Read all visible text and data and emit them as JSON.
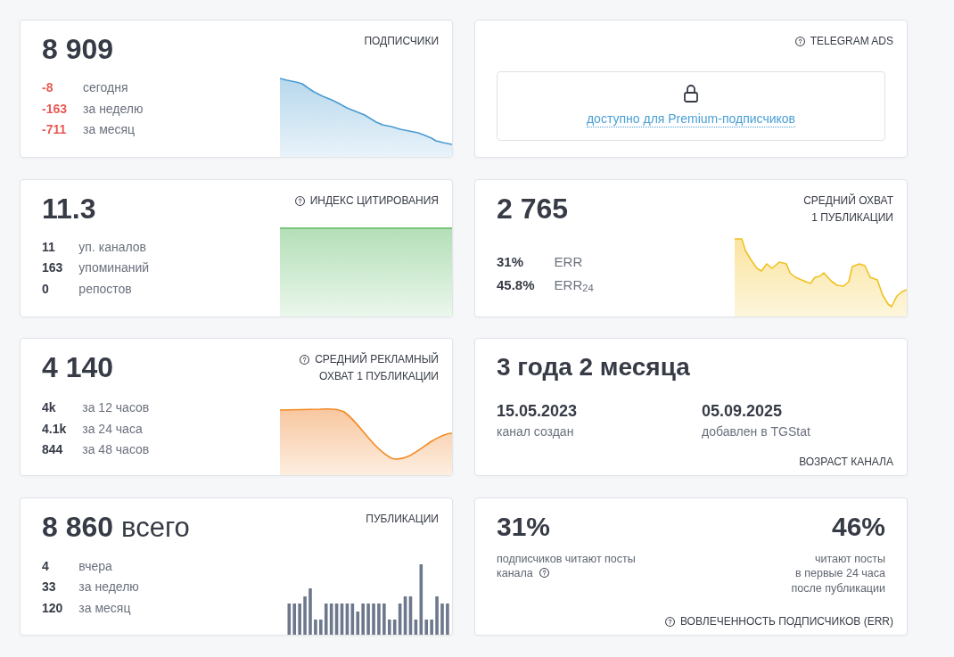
{
  "cards": [
    {
      "kind": "stat",
      "value": "8 909",
      "title_lines": [
        "ПОДПИСЧИКИ"
      ],
      "info_icon": false,
      "stats": [
        {
          "value": "-8",
          "label": "сегодня",
          "negative": true
        },
        {
          "value": "-163",
          "label": "за неделю",
          "negative": true
        },
        {
          "value": "-711",
          "label": "за месяц",
          "negative": true
        }
      ]
    },
    {
      "kind": "locked",
      "title_lines": [
        "TELEGRAM ADS"
      ],
      "info_icon": true,
      "link": "доступно для Premium-подписчиков"
    },
    {
      "kind": "stat",
      "value": "11.3",
      "title_lines": [
        "ИНДЕКС ЦИТИРОВАНИЯ"
      ],
      "info_icon": true,
      "stats": [
        {
          "value": "11",
          "label": "уп. каналов",
          "negative": false
        },
        {
          "value": "163",
          "label": "упоминаний",
          "negative": false
        },
        {
          "value": "0",
          "label": "репостов",
          "negative": false
        }
      ]
    },
    {
      "kind": "stat",
      "value": "2 765",
      "title_lines": [
        "СРЕДНИЙ ОХВАТ",
        "1 ПУБЛИКАЦИИ"
      ],
      "info_icon": false,
      "stats": [
        {
          "value": "31%",
          "label": "ERR",
          "negative": false
        },
        {
          "value": "45.8%",
          "label": "ERR$_{24}$",
          "negative": false
        }
      ]
    },
    {
      "kind": "stat",
      "value": "4 140",
      "title_lines": [
        "СРЕДНИЙ РЕКЛАМНЫЙ",
        "ОХВАТ 1 ПУБЛИКАЦИИ"
      ],
      "info_icon": true,
      "stats": [
        {
          "value": "4k",
          "label": "за 12 часов",
          "negative": false
        },
        {
          "value": "4.1k",
          "label": "за 24 часа",
          "negative": false
        },
        {
          "value": "844",
          "label": "за 48 часов",
          "negative": false
        }
      ]
    },
    {
      "kind": "age",
      "value": "3 года 2 месяца",
      "title_lines": [
        "ВОЗРАСТ КАНАЛА"
      ],
      "info_icon": false,
      "dates": [
        {
          "value": "15.05.2023",
          "label": "канал создан"
        },
        {
          "value": "05.09.2025",
          "label": "добавлен в TGStat"
        }
      ]
    },
    {
      "kind": "stat",
      "value": "8 860",
      "unit": "всего",
      "title_lines": [
        "ПУБЛИКАЦИИ"
      ],
      "info_icon": false,
      "stats": [
        {
          "value": "4",
          "label": "вчера",
          "negative": false
        },
        {
          "value": "33",
          "label": "за неделю",
          "negative": false
        },
        {
          "value": "120",
          "label": "за месяц",
          "negative": false
        }
      ]
    },
    {
      "kind": "engagement",
      "title_lines": [
        "ВОВЛЕЧЕННОСТЬ ПОДПИСЧИКОВ (ERR)"
      ],
      "info_icon": true,
      "metrics": [
        {
          "value": "31%",
          "caption_lines": [
            "подписчиков читают посты",
            "канала"
          ],
          "info_icon": true
        },
        {
          "value": "46%",
          "caption_lines": [
            "читают посты",
            "в первые 24 часа",
            "после публикации"
          ],
          "info_icon": false
        }
      ]
    }
  ]
}
